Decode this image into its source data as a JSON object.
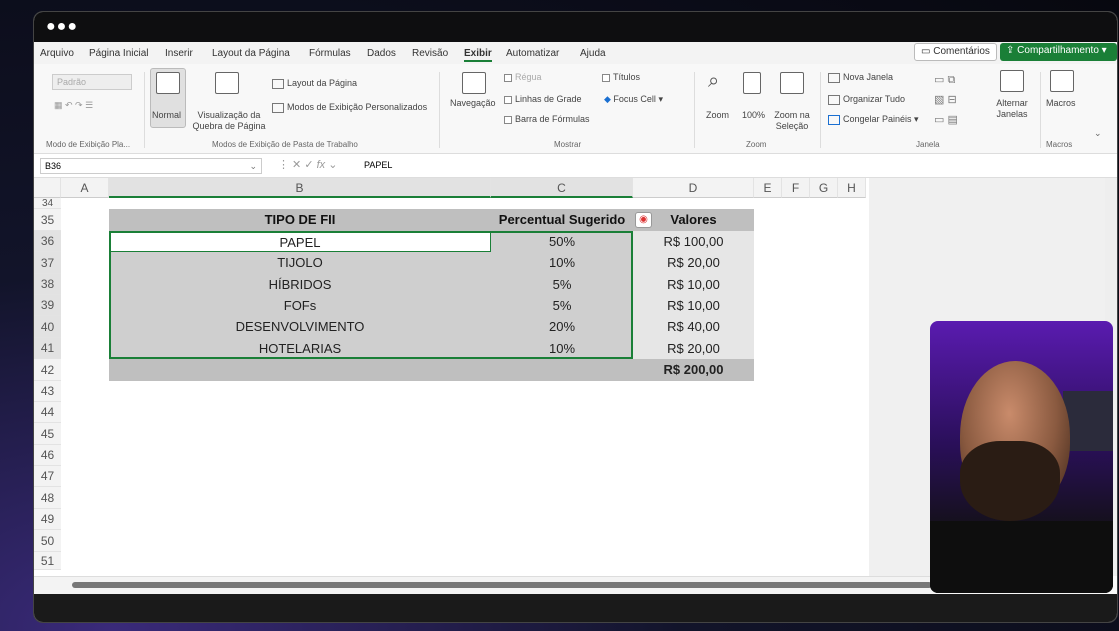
{
  "window": {
    "dots": "●●●"
  },
  "menu": {
    "items": [
      "Arquivo",
      "Página Inicial",
      "Inserir",
      "Layout da Página",
      "Fórmulas",
      "Dados",
      "Revisão",
      "Exibir",
      "Automatizar",
      "Ajuda"
    ],
    "active": "Exibir",
    "comments_label": "Comentários",
    "share_label": "Compartilhamento"
  },
  "ribbon": {
    "modo_dropdown": "Padrão",
    "normal": "Normal",
    "quebra": "Visualização da Quebra de Página",
    "layout": "Layout da Página",
    "personalizados": "Modos de Exibição Personalizados",
    "navegacao": "Navegação",
    "regua": "Régua",
    "linhas_grade": "Linhas de Grade",
    "barra_formulas": "Barra de Fórmulas",
    "titulos": "Títulos",
    "focus_cell": "Focus Cell",
    "zoom": "Zoom",
    "zoom100": "100%",
    "zoom_selecao": "Zoom na Seleção",
    "nova_janela": "Nova Janela",
    "organizar": "Organizar Tudo",
    "congelar": "Congelar Painéis",
    "alternar": "Alternar Janelas",
    "macros": "Macros",
    "groups": {
      "modo_planilha": "Modo de Exibição Pla...",
      "modos_pasta": "Modos de Exibição de Pasta de Trabalho",
      "mostrar": "Mostrar",
      "zoom": "Zoom",
      "janela": "Janela",
      "macros": "Macros"
    }
  },
  "formula_bar": {
    "name_box": "B36",
    "fx": "fx",
    "value": "PAPEL"
  },
  "sheet": {
    "columns": [
      "A",
      "B",
      "C",
      "D",
      "E",
      "F",
      "G",
      "H"
    ],
    "row_numbers": [
      "34",
      "35",
      "36",
      "37",
      "38",
      "39",
      "40",
      "41",
      "42",
      "43",
      "44",
      "45",
      "46",
      "47",
      "48",
      "49",
      "50",
      "51"
    ],
    "table": {
      "headers": [
        "TIPO DE FII",
        "Percentual Sugerido",
        "Valores"
      ],
      "rows": [
        {
          "tipo": "PAPEL",
          "pct": "50%",
          "valor": "R$ 100,00"
        },
        {
          "tipo": "TIJOLO",
          "pct": "10%",
          "valor": "R$ 20,00"
        },
        {
          "tipo": "HÍBRIDOS",
          "pct": "5%",
          "valor": "R$ 10,00"
        },
        {
          "tipo": "FOFs",
          "pct": "5%",
          "valor": "R$ 10,00"
        },
        {
          "tipo": "DESENVOLVIMENTO",
          "pct": "20%",
          "valor": "R$ 40,00"
        },
        {
          "tipo": "HOTELARIAS",
          "pct": "10%",
          "valor": "R$ 20,00"
        }
      ],
      "total": "R$ 200,00"
    }
  },
  "colors": {
    "accent": "#1a7f37",
    "header_fill": "#bfbfbf",
    "data_fill": "#e6e6e6"
  }
}
